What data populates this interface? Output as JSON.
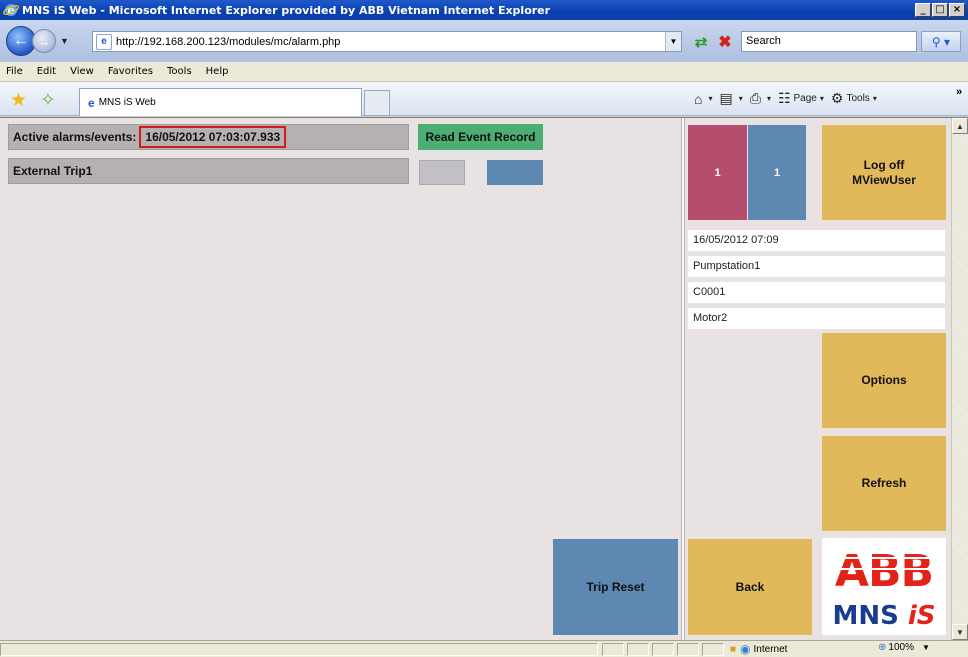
{
  "window": {
    "title": "MNS iS Web - Microsoft Internet Explorer provided by ABB Vietnam Internet Explorer",
    "minimize": "_",
    "maximize": "□",
    "close": "×"
  },
  "address_bar": {
    "url": "http://192.168.200.123/modules/mc/alarm.php",
    "search_placeholder": "Search"
  },
  "menu": [
    "File",
    "Edit",
    "View",
    "Favorites",
    "Tools",
    "Help"
  ],
  "tab": {
    "title": "MNS iS Web"
  },
  "command_bar": {
    "page_label": "Page",
    "tools_label": "Tools"
  },
  "alarm_panel": {
    "header_label": "Active alarms/events:",
    "timestamp": "16/05/2012 07:03:07.933",
    "read_event_button": "Read Event Record",
    "event_name": "External Trip1",
    "trip_reset_button": "Trip Reset"
  },
  "side_panel": {
    "counter_red": "1",
    "counter_blue": "1",
    "logoff_line1": "Log off",
    "logoff_line2": "MViewUser",
    "datetime": "16/05/2012 07:09",
    "station": "Pumpstation1",
    "code": "C0001",
    "device": "Motor2",
    "options_button": "Options",
    "refresh_button": "Refresh",
    "back_button": "Back"
  },
  "status_bar": {
    "zone": "Internet",
    "zoom": "100%"
  },
  "colors": {
    "alarm_red": "#b44e6c",
    "steel_blue": "#5d88b2",
    "green_button": "#4cae72",
    "yellow_button": "#e2b95a",
    "abb_red": "#e2231a",
    "abb_blue": "#1a3c8f"
  },
  "logo": {
    "brand": "ABB",
    "product": "MNS iS"
  }
}
